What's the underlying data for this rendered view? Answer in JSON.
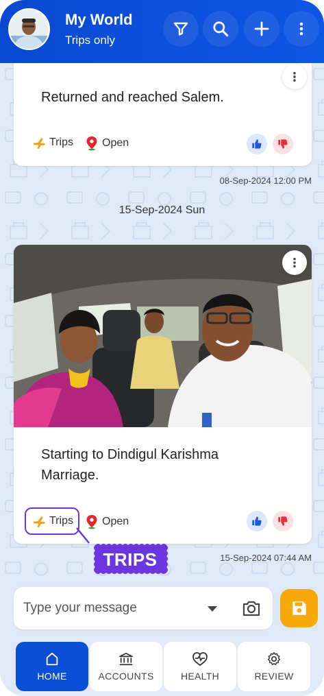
{
  "header": {
    "title": "My World",
    "subtitle": "Trips only",
    "icons": [
      "filter-icon",
      "search-icon",
      "plus-icon",
      "more-vertical-icon"
    ]
  },
  "feed": {
    "post1": {
      "text": "Returned and reached Salem.",
      "category": "Trips",
      "status": "Open",
      "timestamp": "08-Sep-2024 12:00 PM"
    },
    "date_separator": "15-Sep-2024 Sun",
    "post2": {
      "text": "Starting to Dindigul Karishma Marriage.",
      "category": "Trips",
      "status": "Open",
      "timestamp": "15-Sep-2024 07:44 AM"
    }
  },
  "callout": {
    "label": "TRIPS"
  },
  "composer": {
    "placeholder": "Type your message"
  },
  "nav": [
    {
      "label": "HOME",
      "icon": "home-icon"
    },
    {
      "label": "ACCOUNTS",
      "icon": "bank-icon"
    },
    {
      "label": "HEALTH",
      "icon": "heart-pulse-icon"
    },
    {
      "label": "REVIEW",
      "icon": "gear-icon"
    }
  ],
  "colors": {
    "primary": "#0a49d1",
    "accent": "#f7a80a",
    "callout": "#6b35e0",
    "background": "#dfe9f8"
  }
}
